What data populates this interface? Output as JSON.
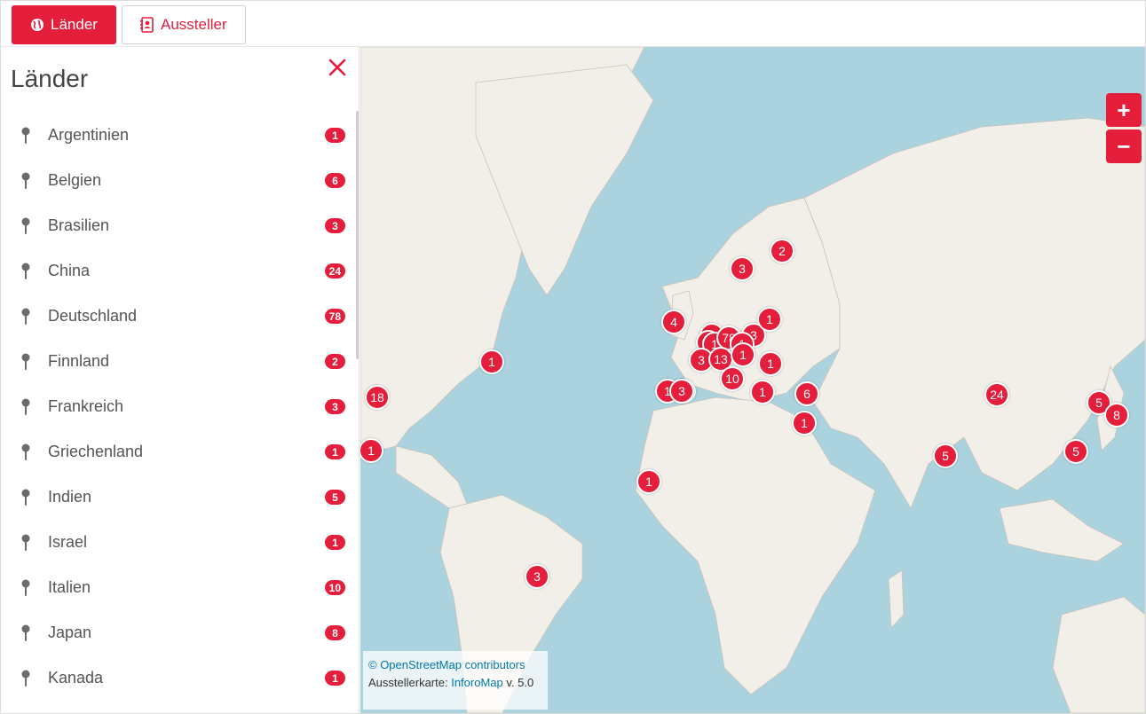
{
  "toolbar": {
    "countries_button": "Länder",
    "exhibitors_button": "Aussteller"
  },
  "sidebar": {
    "title": "Länder",
    "items": [
      {
        "label": "Argentinien",
        "count": "1"
      },
      {
        "label": "Belgien",
        "count": "6"
      },
      {
        "label": "Brasilien",
        "count": "3"
      },
      {
        "label": "China",
        "count": "24"
      },
      {
        "label": "Deutschland",
        "count": "78"
      },
      {
        "label": "Finnland",
        "count": "2"
      },
      {
        "label": "Frankreich",
        "count": "3"
      },
      {
        "label": "Griechenland",
        "count": "1"
      },
      {
        "label": "Indien",
        "count": "5"
      },
      {
        "label": "Israel",
        "count": "1"
      },
      {
        "label": "Italien",
        "count": "10"
      },
      {
        "label": "Japan",
        "count": "8"
      },
      {
        "label": "Kanada",
        "count": "1"
      }
    ]
  },
  "map": {
    "zoom_in": "+",
    "zoom_out": "−",
    "markers": [
      "18",
      "1",
      "1",
      "1",
      "3",
      "1",
      "1",
      "4",
      "5",
      "6",
      "1",
      "78",
      "3",
      "1",
      "3",
      "13",
      "1",
      "1",
      "1",
      "10",
      "1",
      "6",
      "1",
      "3",
      "2",
      "24",
      "5",
      "8",
      "5",
      "5",
      "3"
    ],
    "attribution": {
      "osm_link": "© OpenStreetMap contributors",
      "prefix": "Ausstellerkarte: ",
      "app_link": "InforoMap",
      "version": " v. 5.0"
    }
  },
  "colors": {
    "accent": "#e51e3b",
    "water": "#aad3df",
    "land": "#f2efe9"
  }
}
